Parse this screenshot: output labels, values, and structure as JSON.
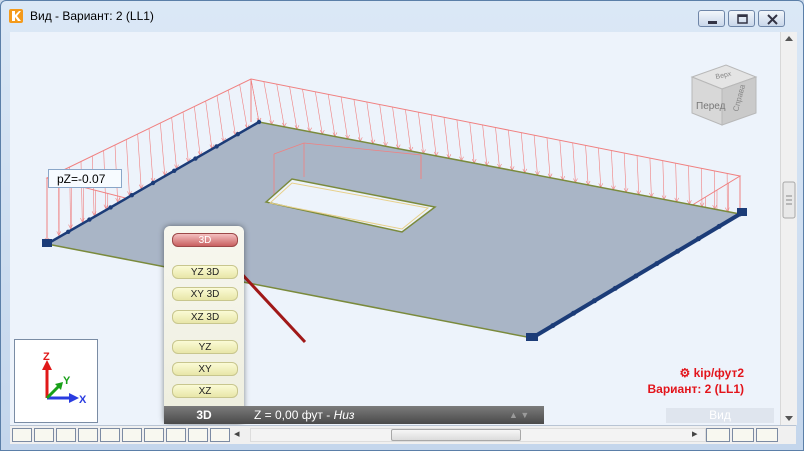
{
  "window": {
    "title": "Вид - Вариант: 2 (LL1)"
  },
  "viewport": {
    "load_label": "pZ=-0.07",
    "nav_cube": {
      "front": "Перед",
      "top": "Верх",
      "right": "Справа"
    },
    "legend": {
      "units": "kip/фут2",
      "case": "Вариант: 2 (LL1)"
    },
    "axes": {
      "x": "X",
      "y": "Y",
      "z": "Z",
      "colors": {
        "x": "#2a3ce0",
        "y": "#18a018",
        "z": "#e01818"
      }
    }
  },
  "view_menu": {
    "items": [
      "3D",
      "YZ 3D",
      "XY 3D",
      "XZ 3D",
      "YZ",
      "XY",
      "XZ"
    ],
    "active": "3D"
  },
  "status": {
    "mode": "3D",
    "z_text": "Z = 0,00 фут - ",
    "z_side": "Низ",
    "view_button": "Вид"
  },
  "colors": {
    "load_line": "#f08080",
    "slab": "#a8b4c4",
    "support": "#1c3c78",
    "arrow": "#a01818",
    "legend": "#e3141b"
  }
}
